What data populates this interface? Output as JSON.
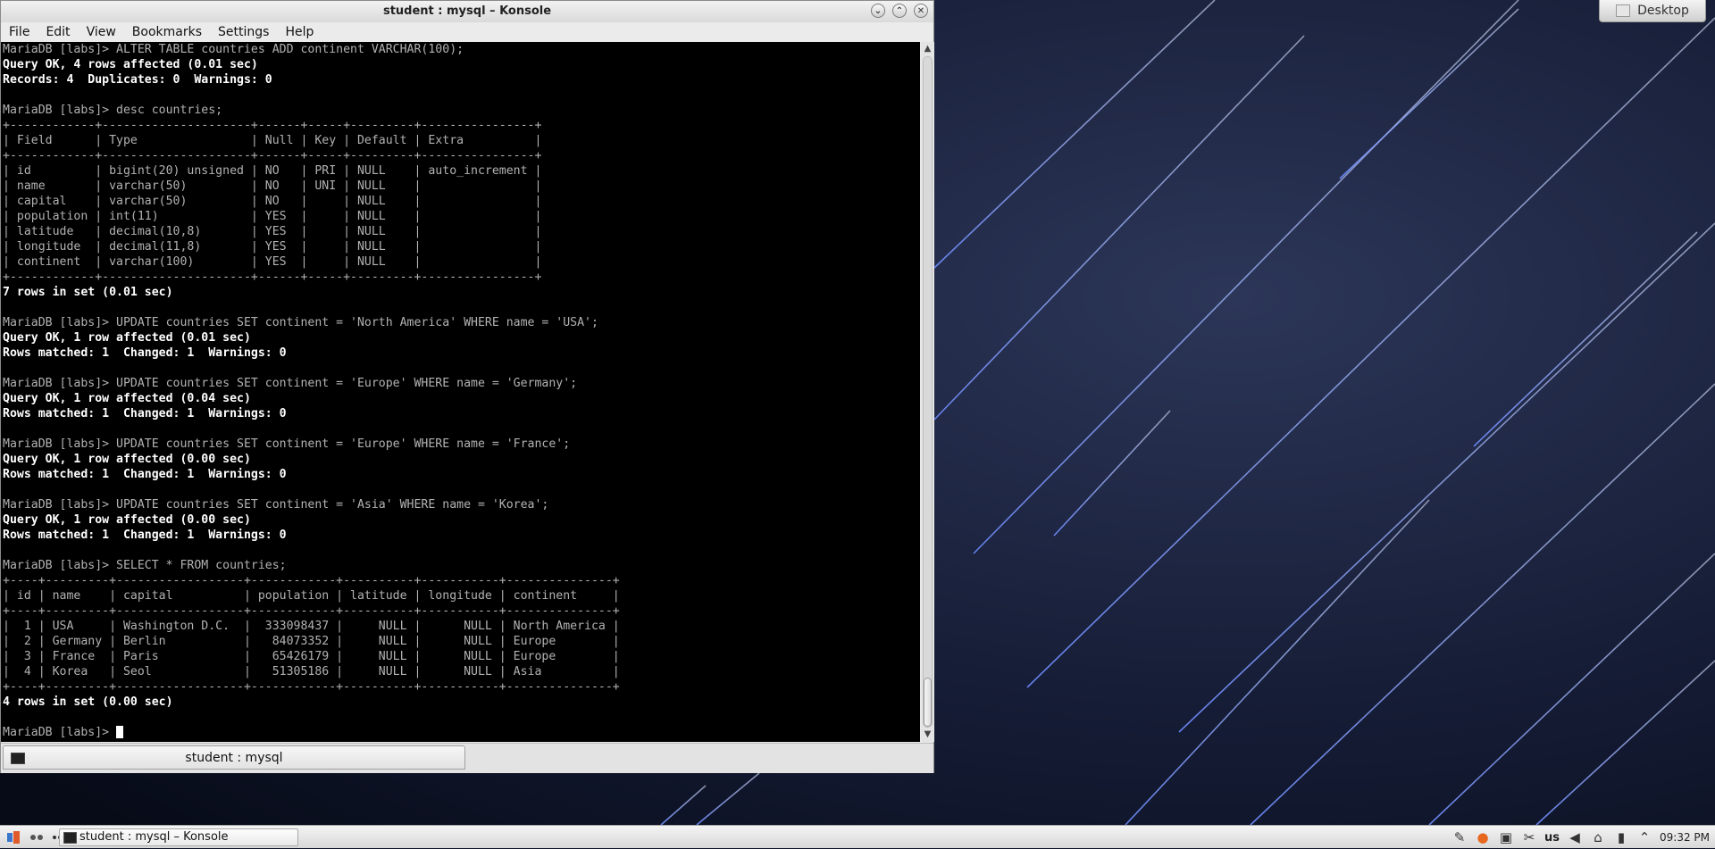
{
  "window": {
    "title": "student : mysql – Konsole",
    "controls": {
      "minimize": "⌄",
      "maximize": "⌃",
      "close": "✕"
    }
  },
  "menu": [
    "File",
    "Edit",
    "View",
    "Bookmarks",
    "Settings",
    "Help"
  ],
  "terminal": {
    "lines": [
      {
        "text": "MariaDB [labs]> ALTER TABLE countries ADD continent VARCHAR(100);",
        "bold": false
      },
      {
        "text": "Query OK, 4 rows affected (0.01 sec)",
        "bold": true
      },
      {
        "text": "Records: 4  Duplicates: 0  Warnings: 0",
        "bold": true
      },
      {
        "text": "",
        "bold": false
      },
      {
        "text": "MariaDB [labs]> desc countries;",
        "bold": false
      },
      {
        "text": "+------------+---------------------+------+-----+---------+----------------+",
        "bold": false
      },
      {
        "text": "| Field      | Type                | Null | Key | Default | Extra          |",
        "bold": false
      },
      {
        "text": "+------------+---------------------+------+-----+---------+----------------+",
        "bold": false
      },
      {
        "text": "| id         | bigint(20) unsigned | NO   | PRI | NULL    | auto_increment |",
        "bold": false
      },
      {
        "text": "| name       | varchar(50)         | NO   | UNI | NULL    |                |",
        "bold": false
      },
      {
        "text": "| capital    | varchar(50)         | NO   |     | NULL    |                |",
        "bold": false
      },
      {
        "text": "| population | int(11)             | YES  |     | NULL    |                |",
        "bold": false
      },
      {
        "text": "| latitude   | decimal(10,8)       | YES  |     | NULL    |                |",
        "bold": false
      },
      {
        "text": "| longitude  | decimal(11,8)       | YES  |     | NULL    |                |",
        "bold": false
      },
      {
        "text": "| continent  | varchar(100)        | YES  |     | NULL    |                |",
        "bold": false
      },
      {
        "text": "+------------+---------------------+------+-----+---------+----------------+",
        "bold": false
      },
      {
        "text": "7 rows in set (0.01 sec)",
        "bold": true
      },
      {
        "text": "",
        "bold": false
      },
      {
        "text": "MariaDB [labs]> UPDATE countries SET continent = 'North America' WHERE name = 'USA';",
        "bold": false
      },
      {
        "text": "Query OK, 1 row affected (0.01 sec)",
        "bold": true
      },
      {
        "text": "Rows matched: 1  Changed: 1  Warnings: 0",
        "bold": true
      },
      {
        "text": "",
        "bold": false
      },
      {
        "text": "MariaDB [labs]> UPDATE countries SET continent = 'Europe' WHERE name = 'Germany';",
        "bold": false
      },
      {
        "text": "Query OK, 1 row affected (0.04 sec)",
        "bold": true
      },
      {
        "text": "Rows matched: 1  Changed: 1  Warnings: 0",
        "bold": true
      },
      {
        "text": "",
        "bold": false
      },
      {
        "text": "MariaDB [labs]> UPDATE countries SET continent = 'Europe' WHERE name = 'France';",
        "bold": false
      },
      {
        "text": "Query OK, 1 row affected (0.00 sec)",
        "bold": true
      },
      {
        "text": "Rows matched: 1  Changed: 1  Warnings: 0",
        "bold": true
      },
      {
        "text": "",
        "bold": false
      },
      {
        "text": "MariaDB [labs]> UPDATE countries SET continent = 'Asia' WHERE name = 'Korea';",
        "bold": false
      },
      {
        "text": "Query OK, 1 row affected (0.00 sec)",
        "bold": true
      },
      {
        "text": "Rows matched: 1  Changed: 1  Warnings: 0",
        "bold": true
      },
      {
        "text": "",
        "bold": false
      },
      {
        "text": "MariaDB [labs]> SELECT * FROM countries;",
        "bold": false
      },
      {
        "text": "+----+---------+------------------+------------+----------+-----------+---------------+",
        "bold": false
      },
      {
        "text": "| id | name    | capital          | population | latitude | longitude | continent     |",
        "bold": false
      },
      {
        "text": "+----+---------+------------------+------------+----------+-----------+---------------+",
        "bold": false
      },
      {
        "text": "|  1 | USA     | Washington D.C.  |  333098437 |     NULL |      NULL | North America |",
        "bold": false
      },
      {
        "text": "|  2 | Germany | Berlin           |   84073352 |     NULL |      NULL | Europe        |",
        "bold": false
      },
      {
        "text": "|  3 | France  | Paris            |   65426179 |     NULL |      NULL | Europe        |",
        "bold": false
      },
      {
        "text": "|  4 | Korea   | Seol             |   51305186 |     NULL |      NULL | Asia          |",
        "bold": false
      },
      {
        "text": "+----+---------+------------------+------------+----------+-----------+---------------+",
        "bold": false
      },
      {
        "text": "4 rows in set (0.00 sec)",
        "bold": true
      },
      {
        "text": "",
        "bold": false
      }
    ],
    "prompt": "MariaDB [labs]> "
  },
  "tab": {
    "label": "student : mysql"
  },
  "desktop_button": {
    "label": "Desktop"
  },
  "taskbar": {
    "task_label": "student : mysql – Konsole",
    "keyboard_layout": "us",
    "clock": "09:32 PM"
  },
  "colors": {
    "terminal_bg": "#000000",
    "terminal_fg": "#b2b2b2",
    "wallpaper": "#101830"
  }
}
